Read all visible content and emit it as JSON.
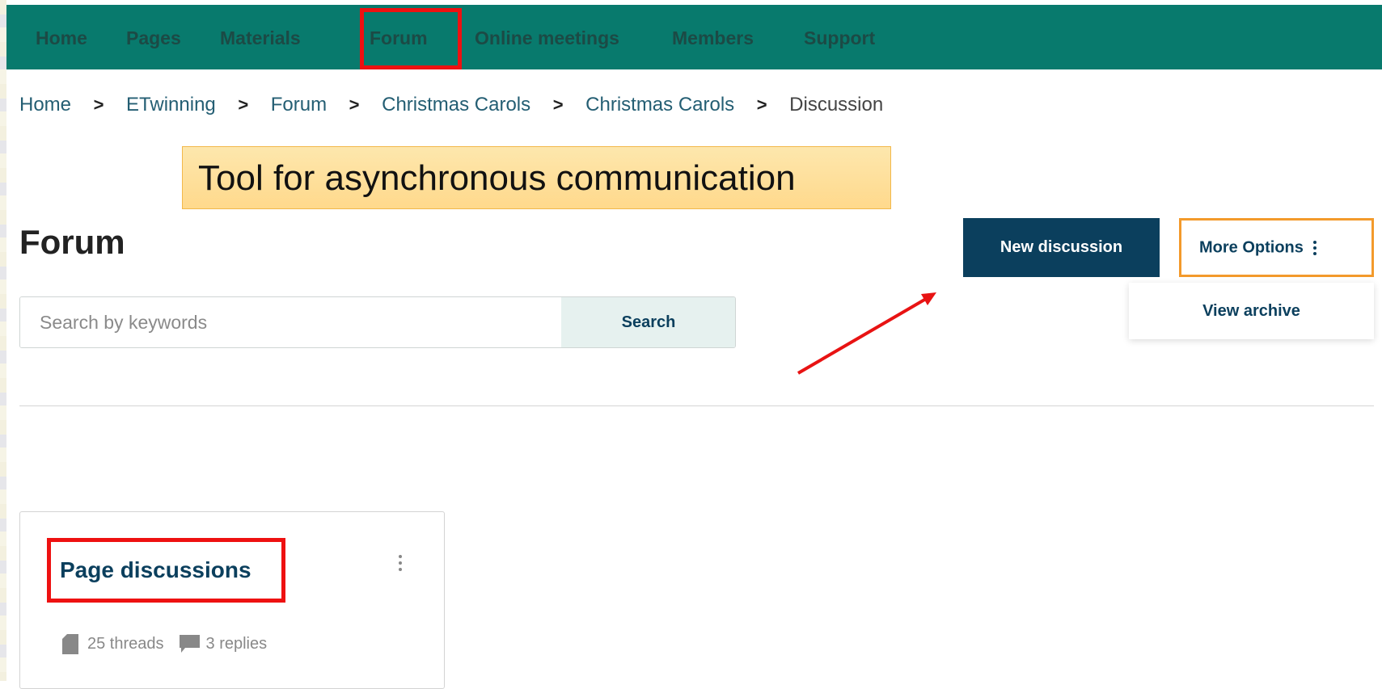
{
  "nav": {
    "items": [
      {
        "label": "Home"
      },
      {
        "label": "Pages"
      },
      {
        "label": "Materials"
      },
      {
        "label": "Forum"
      },
      {
        "label": "Online meetings"
      },
      {
        "label": "Members"
      },
      {
        "label": "Support"
      }
    ],
    "active": "Forum"
  },
  "breadcrumb": {
    "items": [
      "Home",
      "ETwinning",
      "Forum",
      "Christmas Carols",
      "Christmas Carols",
      "Discussion"
    ],
    "separator": ">"
  },
  "callout": {
    "text": "Tool for asynchronous communication"
  },
  "page": {
    "title": "Forum"
  },
  "actions": {
    "new_discussion": "New discussion",
    "more_options": "More Options",
    "dropdown": {
      "view_archive": "View archive"
    }
  },
  "search": {
    "placeholder": "Search by keywords",
    "value": "",
    "button": "Search"
  },
  "card": {
    "title": "Page discussions",
    "threads": "25 threads",
    "replies": "3 replies"
  },
  "colors": {
    "nav_bg": "#087a6d",
    "primary": "#0b3f5d",
    "highlight": "#ee1111",
    "more_border": "#f39a2b",
    "callout_bg": "#ffd98c"
  },
  "icons": [
    "kebab-icon",
    "doc-icon",
    "chat-icon",
    "arrow-annotation"
  ]
}
